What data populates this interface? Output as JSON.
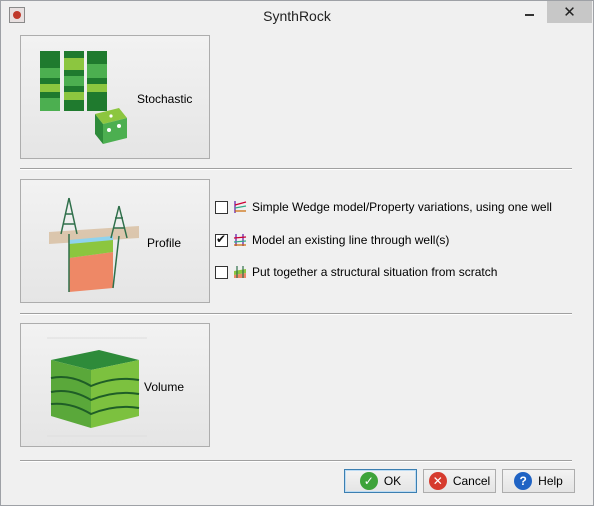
{
  "window": {
    "title": "SynthRock"
  },
  "sections": {
    "stochastic": {
      "label": "Stochastic"
    },
    "profile": {
      "label": "Profile"
    },
    "volume": {
      "label": "Volume"
    }
  },
  "profile_options": [
    {
      "label": "Simple Wedge model/Property variations, using one well",
      "checked": false
    },
    {
      "label": "Model an existing line through well(s)",
      "checked": true
    },
    {
      "label": "Put together a structural situation from scratch",
      "checked": false
    }
  ],
  "footer": {
    "ok_label": "OK",
    "cancel_label": "Cancel",
    "help_label": "Help"
  },
  "colors": {
    "green_dark": "#1f7a2e",
    "green_light": "#8cc63f",
    "salmon": "#ee8866",
    "sky": "#8fd3ee"
  }
}
